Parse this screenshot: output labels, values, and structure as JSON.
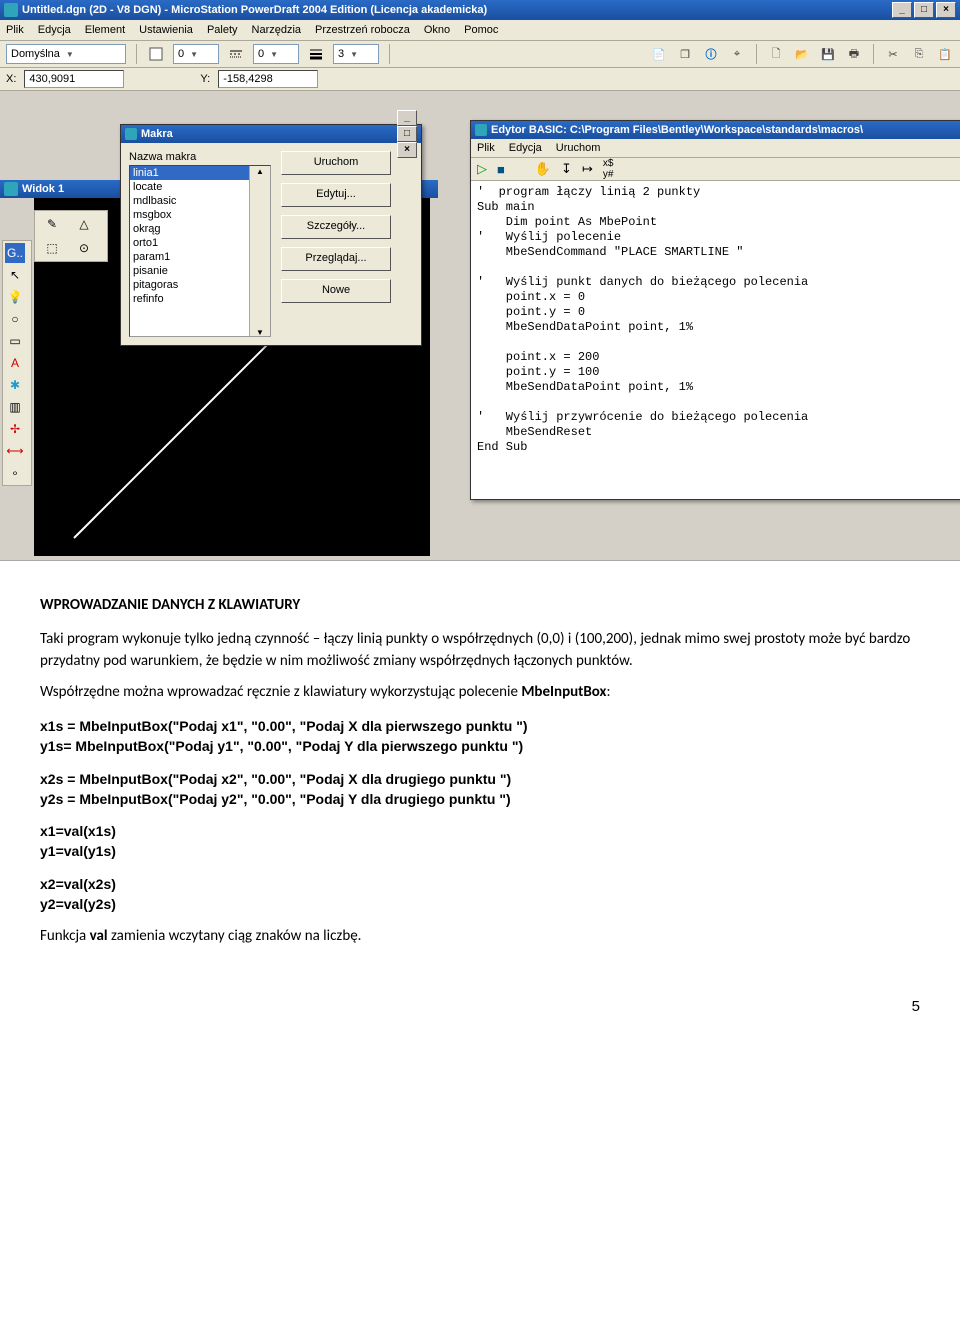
{
  "titlebar": {
    "text": "Untitled.dgn (2D - V8 DGN) - MicroStation PowerDraft 2004 Edition (Licencja akademicka)"
  },
  "menus": {
    "plik": "Plik",
    "edycja": "Edycja",
    "element": "Element",
    "ustawienia": "Ustawienia",
    "palety": "Palety",
    "narzedzia": "Narzędzia",
    "przestrzen": "Przestrzeń robocza",
    "okno": "Okno",
    "pomoc": "Pomoc"
  },
  "toolbar": {
    "combo": "Domyślna",
    "v0": "0",
    "v1": "0",
    "v2": "3"
  },
  "coords": {
    "xl": "X:",
    "x": "430,9091",
    "yl": "Y:",
    "y": "-158,4298"
  },
  "widok": {
    "title": "Widok 1"
  },
  "makra": {
    "title": "Makra",
    "label": "Nazwa makra",
    "items": [
      "linia1",
      "locate",
      "mdlbasic",
      "msgbox",
      "okrąg",
      "orto1",
      "param1",
      "pisanie",
      "pitagoras",
      "refinfo"
    ],
    "btn": {
      "uruchom": "Uruchom",
      "edytuj": "Edytuj...",
      "szczegoly": "Szczegóły...",
      "przegladaj": "Przeglądaj...",
      "nowe": "Nowe"
    }
  },
  "basic": {
    "title": "Edytor BASIC: C:\\Program Files\\Bentley\\Workspace\\standards\\macros\\",
    "menus": {
      "plik": "Plik",
      "edycja": "Edycja",
      "uruchom": "Uruchom"
    },
    "code": "'  program łączy linią 2 punkty\nSub main\n    Dim point As MbePoint\n'   Wyślij polecenie\n    MbeSendCommand \"PLACE SMARTLINE \"\n\n'   Wyślij punkt danych do bieżącego polecenia\n    point.x = 0\n    point.y = 0\n    MbeSendDataPoint point, 1%\n\n    point.x = 200\n    point.y = 100\n    MbeSendDataPoint point, 1%\n\n'   Wyślij przywrócenie do bieżącego polecenia\n    MbeSendReset\nEnd Sub"
  },
  "doc": {
    "h": "WPROWADZANIE DANYCH Z KLAWIATURY",
    "p1": "Taki program wykonuje tylko jedną czynność – łączy linią punkty o współrzędnych (0,0) i (100,200), jednak mimo swej prostoty może być bardzo przydatny pod warunkiem, że będzie w nim możliwość zmiany współrzędnych łączonych punktów.",
    "p2a": "Współrzędne można wprowadzać ręcznie z klawiatury wykorzystując polecenie ",
    "p2b": "MbeInputBox",
    "p2c": ":",
    "c1": "x1s = MbeInputBox(\"Podaj x1\", \"0.00\", \"Podaj X dla pierwszego punktu \")\ny1s= MbeInputBox(\"Podaj y1\", \"0.00\", \"Podaj Y dla pierwszego punktu \")",
    "c2": "x2s = MbeInputBox(\"Podaj x2\", \"0.00\", \"Podaj X dla drugiego punktu \")\ny2s = MbeInputBox(\"Podaj y2\", \"0.00\", \"Podaj Y dla drugiego punktu \")",
    "c3": "x1=val(x1s)\n y1=val(y1s)",
    "c4": "x2=val(x2s)\n y2=val(y2s)",
    "p3a": "Funkcja ",
    "p3b": "val",
    "p3c": " zamienia wczytany ciąg znaków na liczbę.",
    "page": "5"
  }
}
